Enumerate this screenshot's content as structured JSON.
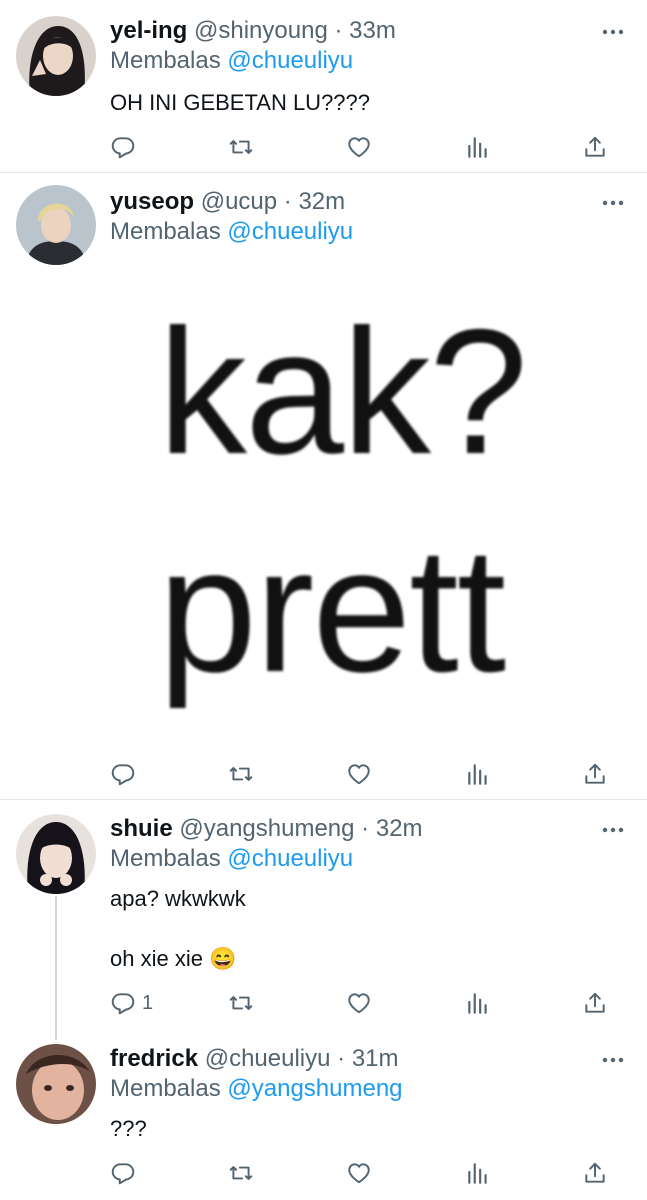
{
  "tweets": [
    {
      "name": "yel-ing",
      "handle": "@shinyoung",
      "time": "33m",
      "reply_prefix": "Membalas",
      "reply_to": "@chueuliyu",
      "text_lines": [
        "OH INI GEBETAN LU????"
      ],
      "reply_count": ""
    },
    {
      "name": "yuseop",
      "handle": "@ucup",
      "time": "32m",
      "reply_prefix": "Membalas",
      "reply_to": "@chueuliyu",
      "media_text": [
        "kak?",
        "prett"
      ],
      "reply_count": ""
    },
    {
      "name": "shuie",
      "handle": "@yangshumeng",
      "time": "32m",
      "reply_prefix": "Membalas",
      "reply_to": "@chueuliyu",
      "text_lines": [
        "apa? wkwkwk",
        "oh xie xie 😄"
      ],
      "reply_count": "1"
    },
    {
      "name": "fredrick",
      "handle": "@chueuliyu",
      "time": "31m",
      "reply_prefix": "Membalas",
      "reply_to": "@yangshumeng",
      "text_lines": [
        "???"
      ],
      "reply_count": ""
    }
  ],
  "separator": "·",
  "icons": [
    "reply-icon",
    "retweet-icon",
    "like-icon",
    "views-icon",
    "share-icon",
    "more-icon"
  ],
  "colors": {
    "link": "#1d9bf0",
    "muted": "#536471",
    "text": "#0f1419",
    "divider": "#e3e7ea"
  }
}
